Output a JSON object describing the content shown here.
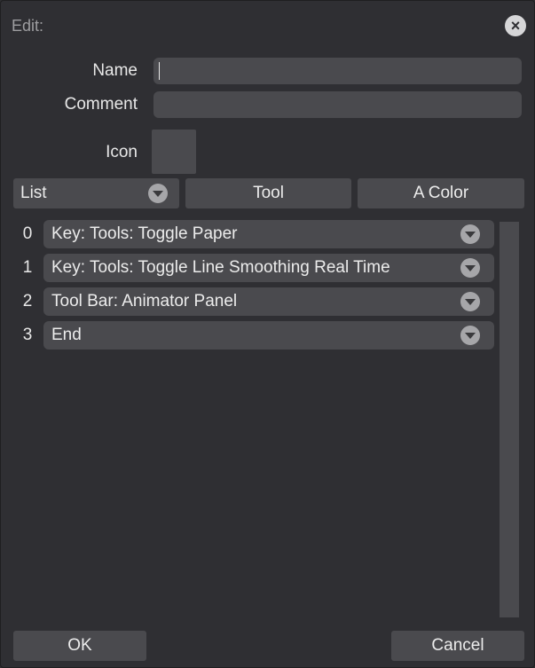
{
  "window": {
    "title": "Edit:",
    "close_icon": "close-icon"
  },
  "form": {
    "name_label": "Name",
    "name_value": "",
    "comment_label": "Comment",
    "comment_value": "",
    "icon_label": "Icon"
  },
  "tabs": {
    "list_label": "List",
    "tool_label": "Tool",
    "color_label": "A Color"
  },
  "list": {
    "items": [
      {
        "index": "0",
        "label": "Key: Tools: Toggle Paper"
      },
      {
        "index": "1",
        "label": "Key: Tools: Toggle Line Smoothing Real Time"
      },
      {
        "index": "2",
        "label": "Tool Bar: Animator Panel"
      },
      {
        "index": "3",
        "label": "End"
      }
    ]
  },
  "footer": {
    "ok_label": "OK",
    "cancel_label": "Cancel"
  },
  "colors": {
    "background": "#2f2f33",
    "control": "#4a4a4e",
    "text": "#ececec",
    "muted_text": "#9d9da0"
  }
}
